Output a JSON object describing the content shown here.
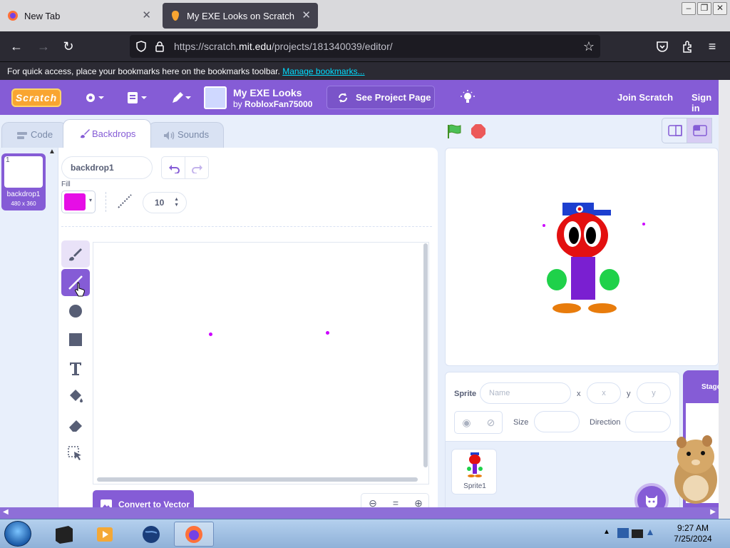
{
  "browser": {
    "tabs": [
      {
        "title": "New Tab",
        "active": false
      },
      {
        "title": "My EXE Looks on Scratch",
        "active": true
      }
    ],
    "url_prefix": "https://scratch.",
    "url_domain": "mit.edu",
    "url_path": "/projects/181340039/editor/",
    "bookmarks_text": "For quick access, place your bookmarks here on the bookmarks toolbar.",
    "bookmarks_link": "Manage bookmarks..."
  },
  "header": {
    "logo": "Scratch",
    "project_title": "My EXE Looks",
    "by_label": "by",
    "author": "RobloxFan75000",
    "see_project_label": "See Project Page",
    "join_label": "Join Scratch",
    "signin_label": "Sign in"
  },
  "editor_tabs": [
    {
      "label": "Code",
      "active": false
    },
    {
      "label": "Backdrops",
      "active": true
    },
    {
      "label": "Sounds",
      "active": false
    }
  ],
  "backdrop_list": [
    {
      "number": "1",
      "name": "backdrop1",
      "size": "480 x 360",
      "selected": true
    }
  ],
  "paint": {
    "name_value": "backdrop1",
    "fill_label": "Fill",
    "fill_color": "#e60ee6",
    "brush_size": "10",
    "convert_label": "Convert to Vector",
    "selected_tool": "line",
    "zoom_reset": "="
  },
  "sprite_info": {
    "sprite_label": "Sprite",
    "name_placeholder": "Name",
    "x_label": "x",
    "x_placeholder": "x",
    "y_label": "y",
    "y_placeholder": "y",
    "size_label": "Size",
    "direction_label": "Direction"
  },
  "sprites": [
    {
      "name": "Sprite1"
    }
  ],
  "stage_panel": {
    "label": "Stage"
  },
  "taskbar": {
    "time": "9:27 AM",
    "date": "7/25/2024"
  },
  "colors": {
    "scratch_purple": "#855cd6",
    "editor_bg": "#e8effb",
    "accent_orange": "#f9a531"
  }
}
